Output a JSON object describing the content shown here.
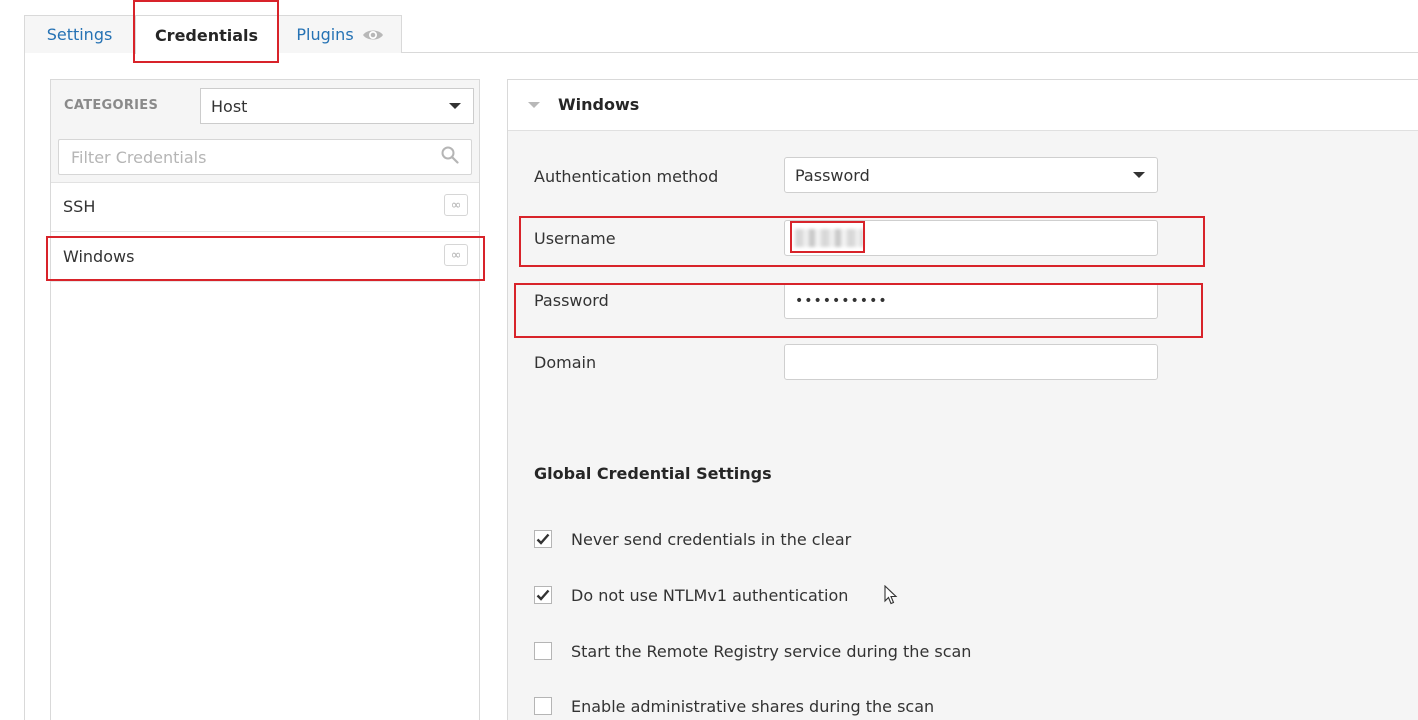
{
  "tabs": [
    {
      "label": "Settings",
      "active": false
    },
    {
      "label": "Credentials",
      "active": true
    },
    {
      "label": "Plugins",
      "active": false,
      "icon": "eye-icon"
    }
  ],
  "left_panel": {
    "categories_label": "CATEGORIES",
    "category_value": "Host",
    "filter_placeholder": "Filter Credentials",
    "items": [
      {
        "label": "SSH",
        "badge": "∞"
      },
      {
        "label": "Windows",
        "badge": "∞"
      }
    ]
  },
  "right_panel": {
    "section_title": "Windows",
    "auth_method_label": "Authentication method",
    "auth_method_value": "Password",
    "username_label": "Username",
    "username_value": "",
    "password_label": "Password",
    "password_value": "••••••••••",
    "domain_label": "Domain",
    "domain_value": "",
    "global_title": "Global Credential Settings",
    "options": [
      {
        "label": "Never send credentials in the clear",
        "checked": true
      },
      {
        "label": "Do not use NTLMv1 authentication",
        "checked": true
      },
      {
        "label": "Start the Remote Registry service during the scan",
        "checked": false
      },
      {
        "label": "Enable administrative shares during the scan",
        "checked": false
      }
    ]
  },
  "colors": {
    "link": "#2572b4",
    "annotation": "#d8232a",
    "panel_bg": "#f5f5f5"
  }
}
